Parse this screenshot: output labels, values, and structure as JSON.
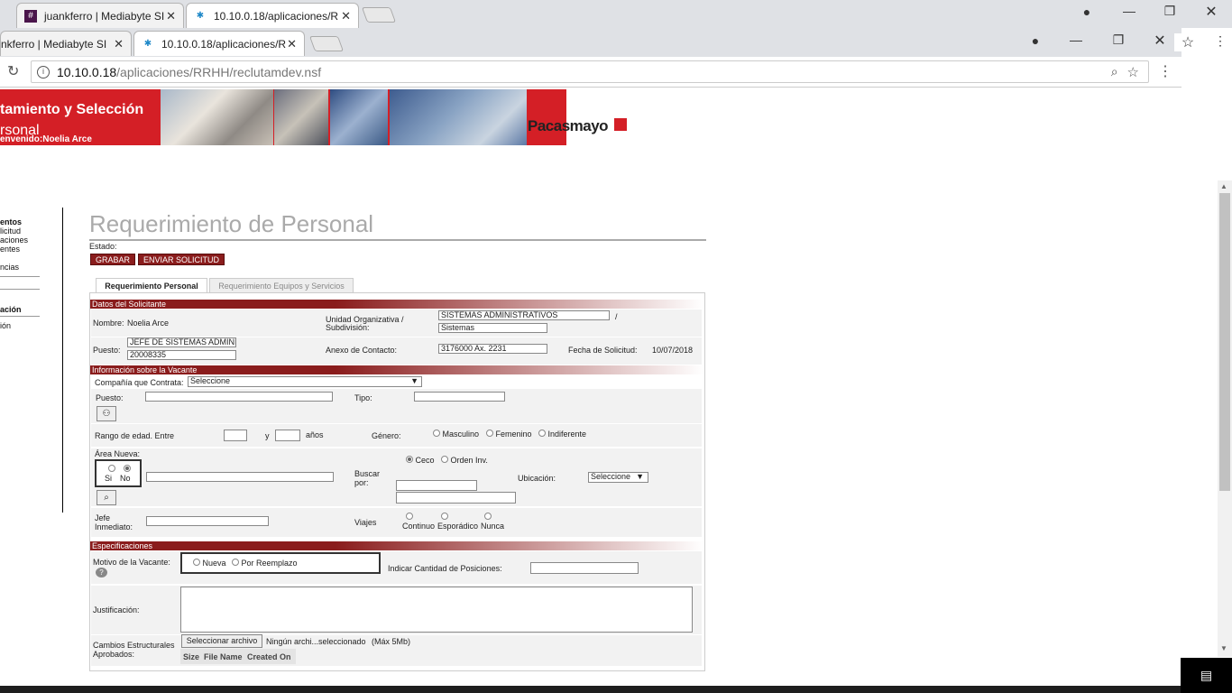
{
  "outer_tabs": [
    {
      "label": "juankferro | Mediabyte SI",
      "icon": "hash-icon",
      "active": false
    },
    {
      "label": "10.10.0.18/aplicaciones/R",
      "icon": "lotus-icon",
      "active": true
    }
  ],
  "inner_tabs": [
    {
      "label": "nkferro | Mediabyte SI",
      "active": false
    },
    {
      "label": "10.10.0.18/aplicaciones/R",
      "active": true
    }
  ],
  "address": {
    "host": "10.10.0.18",
    "path": "/aplicaciones/RRHH/reclutamdev.nsf"
  },
  "banner": {
    "title1": "tamiento y Selección",
    "title2": "rsonal",
    "welcome": "envenido:Noelia Arce",
    "brand": "Pacasmayo"
  },
  "sidebar": {
    "items": [
      "entos",
      "licitud",
      "aciones",
      "entes",
      "ncias",
      "ación",
      "ión"
    ]
  },
  "page": {
    "title": "Requerimiento de Personal",
    "estado_label": "Estado:"
  },
  "buttons": {
    "save": "GRABAR",
    "send": "ENVIAR SOLICITUD"
  },
  "form_tabs": [
    "Requerimiento Personal",
    "Requerimiento Equipos y Servicios"
  ],
  "sections": {
    "solicitante": "Datos del Solicitante",
    "vacante": "Información sobre la Vacante",
    "especificaciones": "Especificaciones"
  },
  "solicitante": {
    "nombre_label": "Nombre:",
    "nombre": "Noelia Arce",
    "unidad_label1": "Unidad Organizativa /",
    "unidad_label2": "Subdivisión:",
    "unidad": "SISTEMAS ADMINISTRATIVOS",
    "slash": "/",
    "subdivision": "Sistemas",
    "puesto_label": "Puesto:",
    "puesto": "JEFE DE SISTEMAS ADMINI",
    "codigo": "20008335",
    "anexo_label": "Anexo de Contacto:",
    "anexo": "3176000 Ax. 2231",
    "fecha_label": "Fecha de Solicitud:",
    "fecha": "10/07/2018"
  },
  "vacante": {
    "compania_label": "Compañía que Contrata:",
    "compania": "Seleccione",
    "puesto_label": "Puesto:",
    "tipo_label": "Tipo:",
    "rango_label": "Rango de edad. Entre",
    "y": "y",
    "anios": "años",
    "genero_label": "Género:",
    "genero_opts": [
      "Masculino",
      "Femenino",
      "Indiferente"
    ],
    "area_label": "Área Nueva:",
    "si": "Si",
    "no": "No",
    "buscar_label1": "Buscar",
    "buscar_label2": "por:",
    "buscar_opts": [
      "Ceco",
      "Orden Inv."
    ],
    "ubicacion_label": "Ubicación:",
    "ubicacion": "Seleccione",
    "jefe_label1": "Jefe",
    "jefe_label2": "Inmediato:",
    "viajes_label": "Viajes",
    "viajes_opts": [
      "Continuo",
      "Esporádico",
      "Nunca"
    ]
  },
  "especificaciones": {
    "motivo_label": "Motivo de la Vacante:",
    "motivo_opts": [
      "Nueva",
      "Por Reemplazo"
    ],
    "cantidad_label": "Indicar Cantidad de Posiciones:",
    "justificacion_label": "Justificación:",
    "cambios_label1": "Cambios Estructurales",
    "cambios_label2": "Aprobados:",
    "file_button": "Seleccionar archivo",
    "file_status": "Ningún archi...seleccionado",
    "file_max": "(Máx 5Mb)",
    "file_cols": [
      "Size",
      "File Name",
      "Created On"
    ]
  },
  "colors": {
    "brand_red": "#d41f26",
    "section_red": "#8a1c1c"
  }
}
